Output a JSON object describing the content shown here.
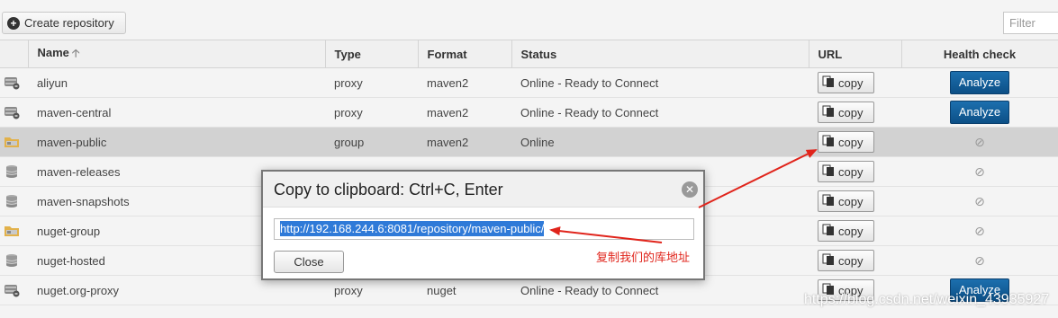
{
  "toolbar": {
    "create_label": "Create repository",
    "filter_placeholder": "Filter"
  },
  "table": {
    "headers": {
      "name": "Name",
      "type": "Type",
      "format": "Format",
      "status": "Status",
      "url": "URL",
      "health": "Health check"
    },
    "copy_label": "copy",
    "analyze_label": "Analyze",
    "rows": [
      {
        "name": "aliyun",
        "type": "proxy",
        "format": "maven2",
        "status": "Online - Ready to Connect",
        "icon": "proxy-server-icon",
        "health": "analyze"
      },
      {
        "name": "maven-central",
        "type": "proxy",
        "format": "maven2",
        "status": "Online - Ready to Connect",
        "icon": "proxy-server-icon",
        "health": "analyze"
      },
      {
        "name": "maven-public",
        "type": "group",
        "format": "maven2",
        "status": "Online",
        "icon": "group-folder-icon",
        "health": "none",
        "selected": true
      },
      {
        "name": "maven-releases",
        "type": "",
        "format": "",
        "status": "",
        "icon": "hosted-db-icon",
        "health": "none"
      },
      {
        "name": "maven-snapshots",
        "type": "",
        "format": "",
        "status": "",
        "icon": "hosted-db-icon",
        "health": "none"
      },
      {
        "name": "nuget-group",
        "type": "",
        "format": "",
        "status": "",
        "icon": "group-folder-icon",
        "health": "none"
      },
      {
        "name": "nuget-hosted",
        "type": "",
        "format": "",
        "status": "",
        "icon": "hosted-db-icon",
        "health": "none"
      },
      {
        "name": "nuget.org-proxy",
        "type": "proxy",
        "format": "nuget",
        "status": "Online - Ready to Connect",
        "icon": "proxy-server-icon",
        "health": "analyze"
      }
    ]
  },
  "modal": {
    "title": "Copy to clipboard: Ctrl+C, Enter",
    "url_value": "http://192.168.244.6:8081/repository/maven-public/",
    "close_label": "Close"
  },
  "annotation": {
    "text": "复制我们的库地址",
    "color": "#e0241b"
  },
  "watermark": "https://blog.csdn.net/weixin_43935927",
  "colors": {
    "analyze_button": "#0c4f86",
    "selection": "#2f7ad8",
    "selected_row": "#d2d2d2"
  }
}
